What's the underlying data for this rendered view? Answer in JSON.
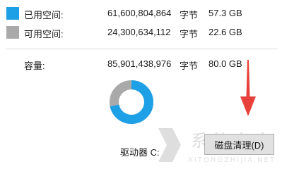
{
  "legend": {
    "used": {
      "label": "已用空间:",
      "bytes": "61,600,804,864",
      "unit": "字节",
      "size": "57.3 GB",
      "color": "#1ea0e6"
    },
    "free": {
      "label": "可用空间:",
      "bytes": "24,300,634,112",
      "unit": "字节",
      "size": "22.6 GB",
      "color": "#a9a9a9"
    }
  },
  "capacity": {
    "label": "容量:",
    "bytes": "85,901,438,976",
    "unit": "字节",
    "size": "80.0 GB"
  },
  "donut": {
    "used_fraction": 0.717,
    "used_color": "#1ea0e6",
    "free_color": "#a9a9a9"
  },
  "drive": {
    "label": "驱动器 C:"
  },
  "cleanup_button": {
    "label": "磁盘清理(D)"
  },
  "arrow": {
    "color": "#e8403a"
  },
  "watermark": {
    "text": "系统之家",
    "url": "XITONGZHIJIA.NET"
  }
}
